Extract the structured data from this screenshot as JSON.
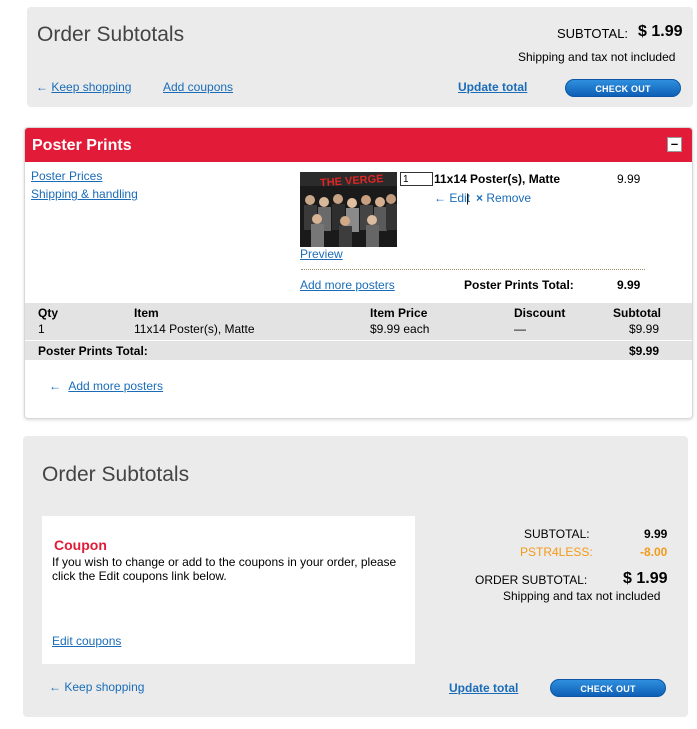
{
  "top_panel": {
    "title": "Order Subtotals",
    "subtotal_label": "SUBTOTAL:",
    "subtotal_value": "$ 1.99",
    "shipping_note": "Shipping and tax not included",
    "keep_shopping": "Keep shopping",
    "add_coupons": "Add coupons",
    "update_total": "Update total",
    "checkout": "CHECK OUT"
  },
  "poster_card": {
    "title": "Poster Prints",
    "collapse": "–",
    "links": {
      "poster_prices": "Poster Prices",
      "shipping_handling": "Shipping & handling"
    },
    "item": {
      "qty": "1",
      "name": "11x14 Poster(s), Matte",
      "price": "9.99",
      "edit": "Edit",
      "remove": "Remove",
      "preview": "Preview",
      "thumbnail_text": "THE VERGE"
    },
    "add_more_posters": "Add more posters",
    "section_total_label": "Poster Prints Total:",
    "section_total_value": "9.99",
    "table": {
      "headers": {
        "qty": "Qty",
        "item": "Item",
        "item_price": "Item Price",
        "discount": "Discount",
        "subtotal": "Subtotal"
      },
      "rows": [
        {
          "qty": "1",
          "item": "11x14 Poster(s), Matte",
          "item_price": "$9.99 each",
          "discount": "—",
          "subtotal": "$9.99"
        }
      ],
      "total_label": "Poster Prints Total:",
      "total_value": "$9.99"
    },
    "add_more_posters_bottom": "Add more posters"
  },
  "bottom_panel": {
    "title": "Order Subtotals",
    "coupon": {
      "heading": "Coupon",
      "text": "If you wish to change or add to the coupons in your order, please click the Edit coupons link below.",
      "edit_link": "Edit coupons"
    },
    "subtotal_label": "SUBTOTAL:",
    "subtotal_value": "9.99",
    "promo_label": "PSTR4LESS:",
    "promo_value": "-8.00",
    "order_subtotal_label": "ORDER SUBTOTAL:",
    "order_subtotal_value": "$ 1.99",
    "shipping_note": "Shipping and tax not included",
    "keep_shopping": "Keep shopping",
    "update_total": "Update total",
    "checkout": "CHECK OUT"
  },
  "colors": {
    "accent_red": "#e21b38",
    "link_blue": "#1a6cb8",
    "promo_orange": "#f29a1a",
    "button_blue": "#1273c7"
  }
}
